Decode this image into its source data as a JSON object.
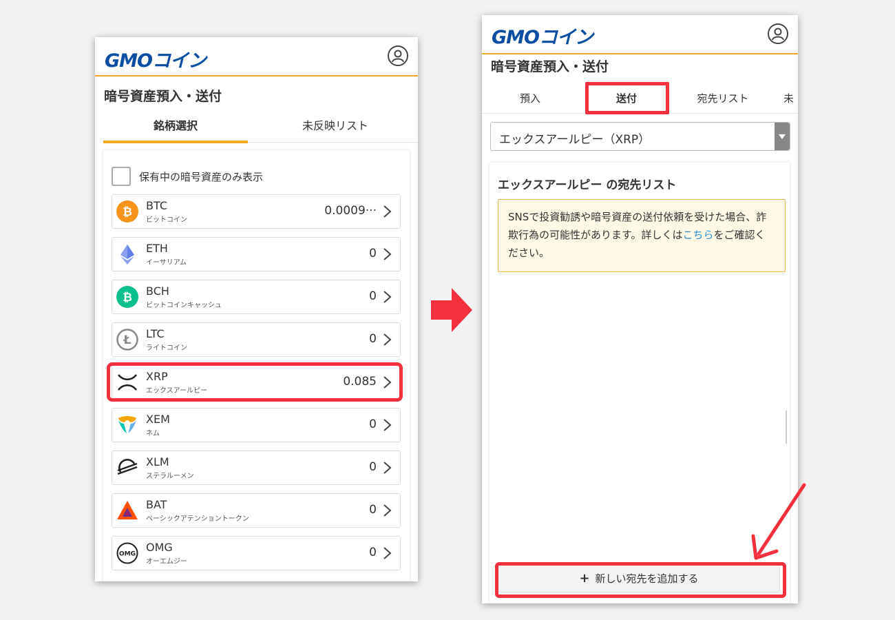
{
  "left": {
    "logo_text": "GMO",
    "logo_jp": "コイン",
    "title": "暗号資産預入・送付",
    "tabs": [
      {
        "label": "銘柄選択"
      },
      {
        "label": "未反映リスト"
      }
    ],
    "only_held_label": "保有中の暗号資産のみ表示",
    "coins": [
      {
        "symbol": "BTC",
        "name": "ビットコイン",
        "value": "0.0009···",
        "icon": "bitcoin-icon",
        "color": "#f7931a"
      },
      {
        "symbol": "ETH",
        "name": "イーサリアム",
        "value": "0",
        "icon": "ethereum-icon",
        "color": "#627eea"
      },
      {
        "symbol": "BCH",
        "name": "ビットコインキャッシュ",
        "value": "0",
        "icon": "bitcoin-cash-icon",
        "color": "#0ac18e"
      },
      {
        "symbol": "LTC",
        "name": "ライトコイン",
        "value": "0",
        "icon": "litecoin-icon",
        "color": "#888888"
      },
      {
        "symbol": "XRP",
        "name": "エックスアールピー",
        "value": "0.085",
        "icon": "xrp-icon",
        "color": "#222222"
      },
      {
        "symbol": "XEM",
        "name": "ネム",
        "value": "0",
        "icon": "nem-icon",
        "color": "#f7a800"
      },
      {
        "symbol": "XLM",
        "name": "ステラルーメン",
        "value": "0",
        "icon": "stellar-icon",
        "color": "#222222"
      },
      {
        "symbol": "BAT",
        "name": "ベーシックアテンショントークン",
        "value": "0",
        "icon": "bat-icon",
        "color": "#ff5000"
      },
      {
        "symbol": "OMG",
        "name": "オーエムジー",
        "value": "0",
        "icon": "omg-icon",
        "color": "#222222"
      }
    ]
  },
  "right": {
    "logo_text": "GMO",
    "logo_jp": "コイン",
    "title": "暗号資産預入・送付",
    "tabs": [
      {
        "label": "預入"
      },
      {
        "label": "送付"
      },
      {
        "label": "宛先リスト"
      },
      {
        "label": "未"
      }
    ],
    "select_value": "エックスアールピー（XRP）",
    "dest_title": "エックスアールピー の宛先リスト",
    "warning_text": "SNSで投資勧誘や暗号資産の送付依頼を受けた場合、詐欺行為の可能性があります。詳しくは",
    "warning_link": "こちら",
    "warning_suffix": "をご確認ください。",
    "add_button_label": "新しい宛先を追加する"
  },
  "colors": {
    "accent": "#f5a623",
    "highlight": "#f3303c",
    "brand": "#0a4ea3",
    "link": "#2b8fd6"
  }
}
